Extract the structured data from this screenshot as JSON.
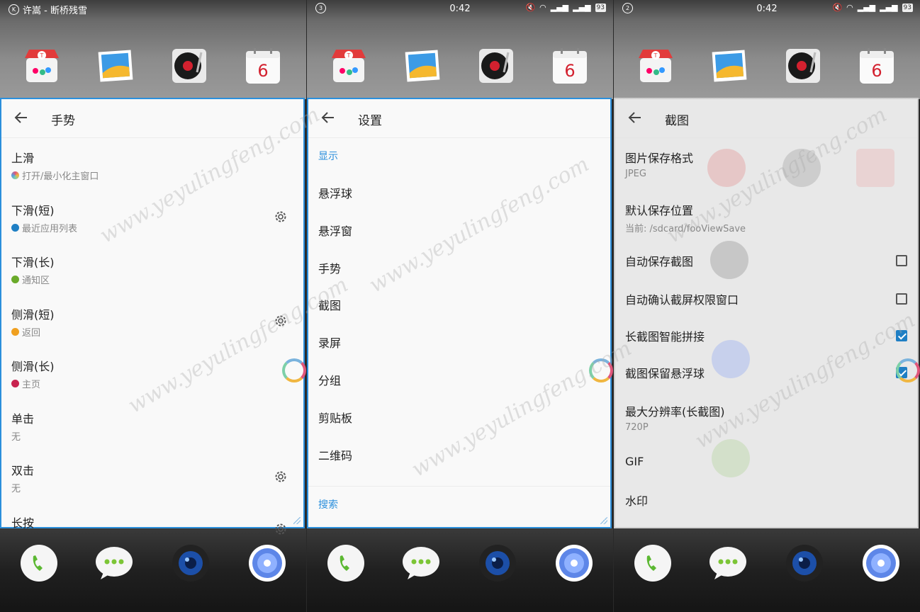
{
  "status": {
    "left_text": "许嵩 - 断桥残雪",
    "time": "0:42",
    "battery": "93",
    "badge2": "3",
    "badge3": "2",
    "badge1": "K"
  },
  "calendar_day": "6",
  "panel1": {
    "title": "手势",
    "rows": [
      {
        "label": "上滑",
        "value": "打开/最小化主窗口",
        "icon": "rainbow-ring-icon",
        "gear": false
      },
      {
        "label": "下滑(短)",
        "value": "最近应用列表",
        "icon": "blue-dot-icon",
        "gear": true
      },
      {
        "label": "下滑(长)",
        "value": "通知区",
        "icon": "green-dot-icon",
        "gear": false
      },
      {
        "label": "侧滑(短)",
        "value": "返回",
        "icon": "orange-dot-icon",
        "gear": true
      },
      {
        "label": "侧滑(长)",
        "value": "主页",
        "icon": "red-home-icon",
        "gear": false
      },
      {
        "label": "单击",
        "value": "无",
        "icon": "",
        "gear": false
      },
      {
        "label": "双击",
        "value": "无",
        "icon": "",
        "gear": true
      },
      {
        "label": "长按",
        "value": "",
        "icon": "",
        "gear": true
      }
    ]
  },
  "panel2": {
    "title": "设置",
    "section1": "显示",
    "items": [
      "悬浮球",
      "悬浮窗",
      "手势",
      "截图",
      "录屏",
      "分组",
      "剪贴板",
      "二维码"
    ],
    "section2": "搜索"
  },
  "panel3": {
    "title": "截图",
    "rows": [
      {
        "label": "图片保存格式",
        "value": "JPEG",
        "check": null
      },
      {
        "label": "默认保存位置",
        "value": "当前: /sdcard/fooViewSave",
        "check": null
      },
      {
        "label": "自动保存截图",
        "value": "",
        "check": false
      },
      {
        "label": "自动确认截屏权限窗口",
        "value": "",
        "check": false
      },
      {
        "label": "长截图智能拼接",
        "value": "",
        "check": true
      },
      {
        "label": "截图保留悬浮球",
        "value": "",
        "check": true
      },
      {
        "label": "最大分辨率(长截图)",
        "value": "720P",
        "check": null
      },
      {
        "label": "GIF",
        "value": "",
        "check": null
      },
      {
        "label": "水印",
        "value": "",
        "check": null
      }
    ]
  },
  "watermark": "www.yeyulingfeng.com",
  "colors": {
    "accent": "#2b8fdc",
    "check_on": "#1f7fc4"
  }
}
